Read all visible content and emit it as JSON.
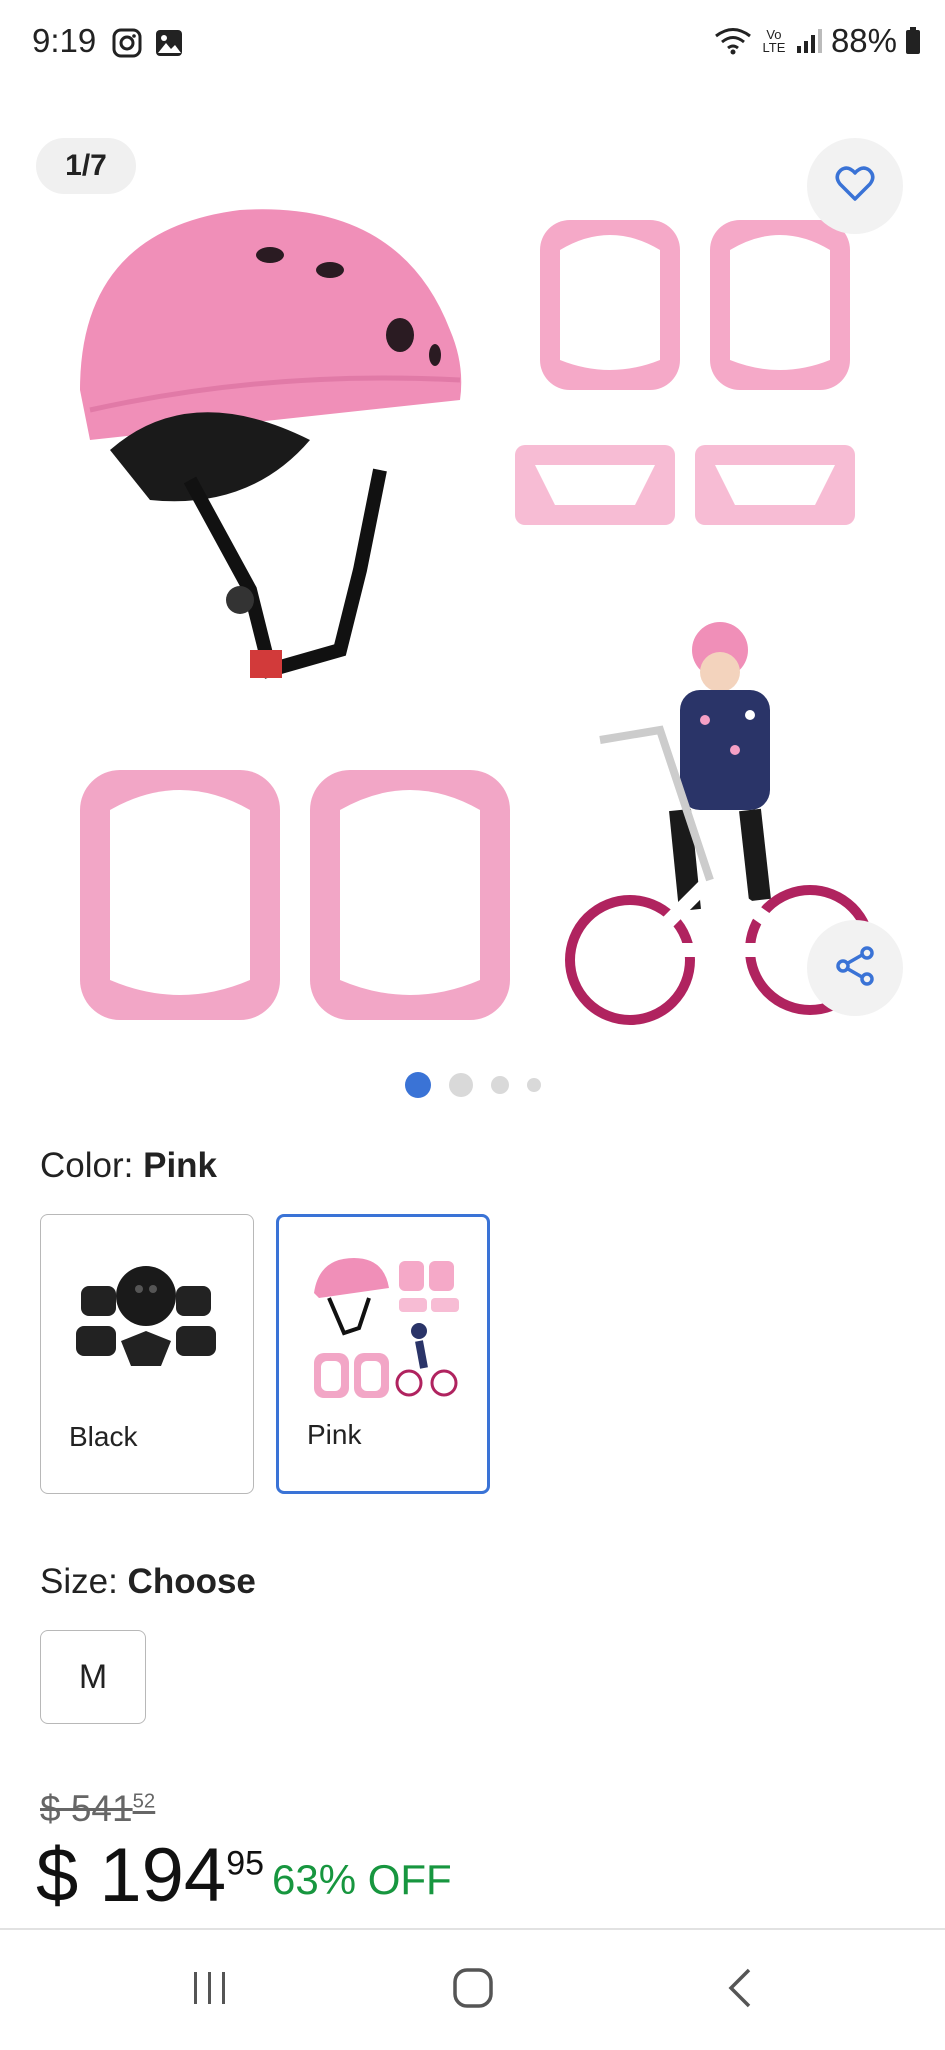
{
  "status_bar": {
    "time": "9:19",
    "network_label": "Vo LTE",
    "battery": "88%"
  },
  "gallery": {
    "counter": "1/7",
    "dots_count": 4,
    "active_dot": 0
  },
  "color": {
    "label": "Color:",
    "selected": "Pink",
    "options": [
      {
        "label": "Black"
      },
      {
        "label": "Pink"
      }
    ]
  },
  "size": {
    "label": "Size:",
    "value": "Choose",
    "options": [
      {
        "label": "M"
      }
    ]
  },
  "price": {
    "original_main": "$ 541",
    "original_cents": "52",
    "current_main": "$ 194",
    "current_cents": "95",
    "discount": "63% OFF"
  },
  "colors": {
    "accent": "#3a73d6",
    "discount": "#17963f",
    "pink": "#f2a6c6"
  }
}
